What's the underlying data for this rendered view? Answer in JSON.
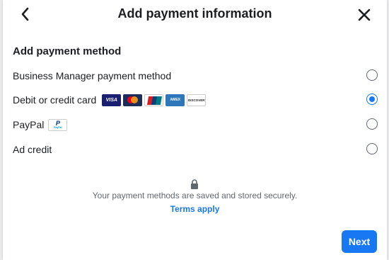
{
  "dialog": {
    "title": "Add payment information",
    "back_icon": "chevron-left-icon",
    "close_icon": "close-icon"
  },
  "section": {
    "heading": "Add payment method"
  },
  "options": [
    {
      "label": "Business Manager payment method",
      "selected": false
    },
    {
      "label": "Debit or credit card",
      "selected": true
    },
    {
      "label": "PayPal",
      "selected": false
    },
    {
      "label": "Ad credit",
      "selected": false
    }
  ],
  "cards": [
    {
      "name": "visa-logo",
      "text": "VISA"
    },
    {
      "name": "mastercard-logo",
      "text": ""
    },
    {
      "name": "unionpay-logo",
      "text": ""
    },
    {
      "name": "amex-logo",
      "text": "AMEX"
    },
    {
      "name": "discover-logo",
      "text": "DISCOVER"
    }
  ],
  "paypal_badge": {
    "mark": "P",
    "word": "PayPal"
  },
  "footer": {
    "lock_icon": "lock-icon",
    "secure_text": "Your payment methods are saved and stored securely.",
    "terms_link": "Terms apply",
    "next_button": "Next"
  },
  "colors": {
    "accent": "#1877f2",
    "text": "#1c1e21",
    "secondary_text": "#606770"
  }
}
